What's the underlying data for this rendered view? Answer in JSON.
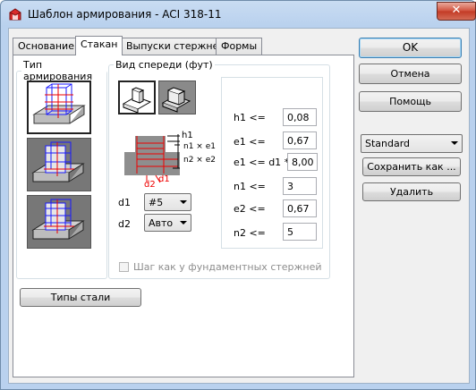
{
  "window": {
    "title": "Шаблон армирования - ACI 318-11",
    "close_symbol": "✕"
  },
  "tabs": [
    {
      "label": "Основание",
      "active": false
    },
    {
      "label": "Стакан",
      "active": true
    },
    {
      "label": "Выпуски стержней",
      "active": false
    },
    {
      "label": "Формы",
      "active": false
    }
  ],
  "reinforcement_type": {
    "legend": "Тип армирования",
    "options": [
      {
        "icon": "cage-template-1-icon",
        "selected": true
      },
      {
        "icon": "cage-template-2-icon",
        "selected": false
      },
      {
        "icon": "cage-template-3-icon",
        "selected": false
      }
    ]
  },
  "front_view": {
    "legend": "Вид спереди (фут)",
    "view_buttons": [
      "pedestal-view-1-icon",
      "pedestal-view-2-icon"
    ],
    "diagram_labels": {
      "h1": "h1",
      "n1e1": "n1 × e1",
      "n2e2": "n2 × e2",
      "d2": "d2",
      "d1": "d1"
    },
    "d1": {
      "label": "d1",
      "value": "#5"
    },
    "d2": {
      "label": "d2",
      "value": "Авто"
    },
    "params": [
      {
        "label": "h1 <=",
        "value": "0,08"
      },
      {
        "label": "e1 <=",
        "value": "0,67"
      },
      {
        "label": "e1 <= d1 *",
        "value": "8,00"
      },
      {
        "label": "n1 <=",
        "value": "3"
      },
      {
        "label": "e2 <=",
        "value": "0,67"
      },
      {
        "label": "n2 <=",
        "value": "5"
      }
    ],
    "checkbox": {
      "label": "Шаг как у фундаментных стержней",
      "checked": false,
      "enabled": false
    }
  },
  "steel_types_button": "Типы стали",
  "buttons": {
    "ok": "OK",
    "cancel": "Отмена",
    "help": "Помощь",
    "save_as": "Сохранить как ...",
    "delete": "Удалить"
  },
  "template_select": {
    "value": "Standard"
  },
  "colors": {
    "title_bg": "#b9d1ee",
    "client_bg": "#f0f0f0",
    "close_red": "#c23a25"
  }
}
